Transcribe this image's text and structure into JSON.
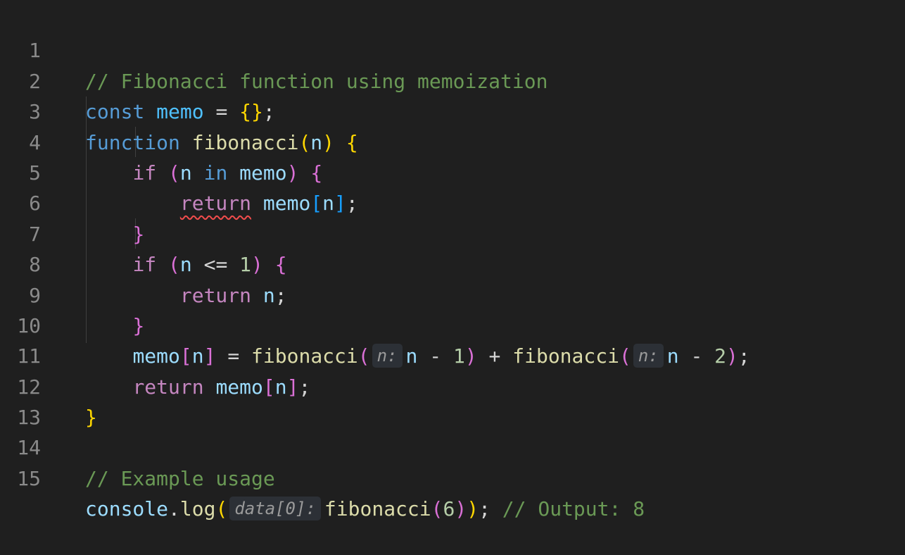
{
  "editor": {
    "line_numbers": [
      "1",
      "2",
      "3",
      "4",
      "5",
      "6",
      "7",
      "8",
      "9",
      "10",
      "11",
      "12",
      "13",
      "14",
      "15"
    ],
    "lines": {
      "l1": {
        "comment": "// Fibonacci function using memoization"
      },
      "l2": {
        "kw": "const",
        "name": "memo",
        "eq": "=",
        "open": "{",
        "close": "}",
        "semi": ";"
      },
      "l3": {
        "kw": "function",
        "fn": "fibonacci",
        "open": "(",
        "param": "n",
        "close": ")",
        "brace": "{"
      },
      "l4": {
        "kw": "if",
        "open": "(",
        "a": "n",
        "op": "in",
        "b": "memo",
        "close": ")",
        "brace": "{"
      },
      "l5": {
        "kw": "return",
        "obj": "memo",
        "open": "[",
        "idx": "n",
        "close": "]",
        "semi": ";"
      },
      "l6": {
        "brace": "}"
      },
      "l7": {
        "kw": "if",
        "open": "(",
        "a": "n",
        "op": "<=",
        "num": "1",
        "close": ")",
        "brace": "{"
      },
      "l8": {
        "kw": "return",
        "val": "n",
        "semi": ";"
      },
      "l9": {
        "brace": "}"
      },
      "l10": {
        "obj": "memo",
        "open": "[",
        "idx": "n",
        "close": "]",
        "eq": "=",
        "fn1": "fibonacci",
        "p1open": "(",
        "hint1": "n:",
        "a1": "n",
        "minus1": "-",
        "n1": "1",
        "p1close": ")",
        "plus": "+",
        "fn2": "fibonacci",
        "p2open": "(",
        "hint2": "n:",
        "a2": "n",
        "minus2": "-",
        "n2": "2",
        "p2close": ")",
        "semi": ";"
      },
      "l11": {
        "kw": "return",
        "obj": "memo",
        "open": "[",
        "idx": "n",
        "close": "]",
        "semi": ";"
      },
      "l12": {
        "brace": "}"
      },
      "l14": {
        "comment": "// Example usage"
      },
      "l15": {
        "obj": "console",
        "dot": ".",
        "method": "log",
        "open": "(",
        "hint": "data[0]:",
        "fn": "fibonacci",
        "fopen": "(",
        "num": "6",
        "fclose": ")",
        "close": ")",
        "semi": ";",
        "comment": "// Output: 8"
      }
    },
    "colors": {
      "background": "#1f1f1f",
      "keyword_declaration": "#569cd6",
      "keyword_control": "#c586c0",
      "function": "#dcdcaa",
      "variable": "#9cdcfe",
      "number": "#b5cea8",
      "comment": "#6a9955",
      "error_squiggle": "#f14c4c"
    }
  }
}
